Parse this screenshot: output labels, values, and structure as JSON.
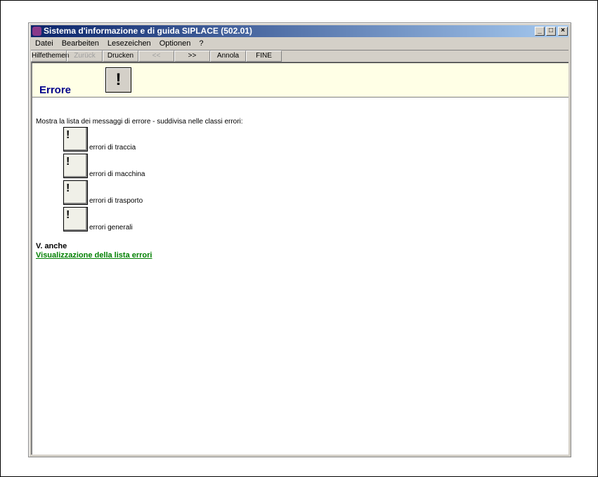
{
  "window": {
    "title": "Sistema d'informazione e di guida SIPLACE (502.01)"
  },
  "menu": [
    "Datei",
    "Bearbeiten",
    "Lesezeichen",
    "Optionen",
    "?"
  ],
  "toolbar": [
    {
      "label": "Hilfethemen",
      "enabled": true
    },
    {
      "label": "Zurück",
      "enabled": false
    },
    {
      "label": "Drucken",
      "enabled": true
    },
    {
      "label": "<<",
      "enabled": false
    },
    {
      "label": ">>",
      "enabled": true
    },
    {
      "label": "Annola",
      "enabled": true
    },
    {
      "label": "FINE",
      "enabled": true
    }
  ],
  "page": {
    "title": "Errore",
    "description": "Mostra la lista dei messaggi di errore - suddivisa nelle classi errori:",
    "items": [
      "errori di traccia",
      "errori di macchina",
      "errori di trasporto",
      "errori generali"
    ],
    "see_also": "V. anche",
    "link": "Visualizzazione della lista errori"
  }
}
